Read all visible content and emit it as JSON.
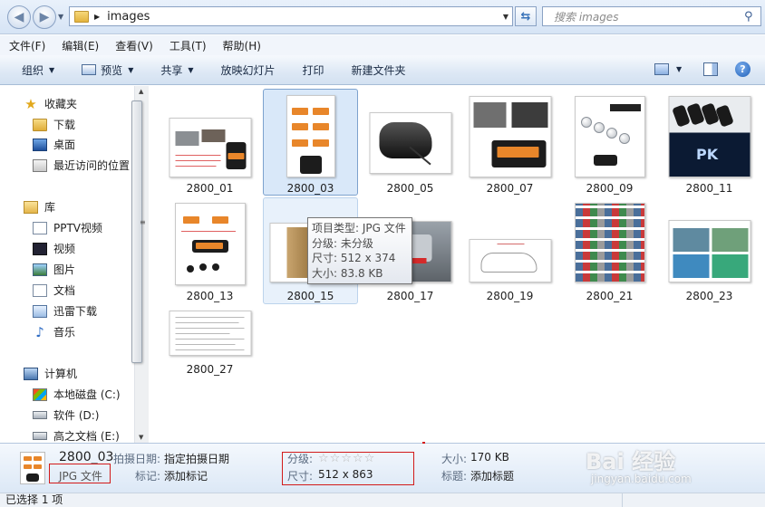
{
  "address": {
    "path_label": "images",
    "search_placeholder": "搜索 images"
  },
  "menu": [
    "文件(F)",
    "编辑(E)",
    "查看(V)",
    "工具(T)",
    "帮助(H)"
  ],
  "toolbar": {
    "organize": "组织",
    "preview": "预览",
    "share": "共享",
    "slideshow": "放映幻灯片",
    "print": "打印",
    "new_folder": "新建文件夹"
  },
  "nav": {
    "favorites": "收藏夹",
    "downloads": "下载",
    "desktop": "桌面",
    "recent": "最近访问的位置",
    "libraries": "库",
    "pptv": "PPTV视频",
    "videos": "视频",
    "pictures": "图片",
    "documents": "文档",
    "thunder": "迅雷下载",
    "music": "音乐",
    "computer": "计算机",
    "drive_c": "本地磁盘 (C:)",
    "drive_d": "软件 (D:)",
    "drive_e": "高之文档 (E:)"
  },
  "files": [
    "2800_01",
    "2800_03",
    "2800_05",
    "2800_07",
    "2800_09",
    "2800_11",
    "2800_13",
    "2800_15",
    "2800_17",
    "2800_19",
    "2800_21",
    "2800_23",
    "2800_27"
  ],
  "tooltip": {
    "type": "项目类型: JPG 文件",
    "rating": "分级: 未分级",
    "dimensions": "尺寸: 512 x 374",
    "size": "大小: 83.8 KB"
  },
  "details": {
    "name": "2800_03",
    "type": "JPG 文件",
    "date_label": "拍摄日期:",
    "date_value": "指定拍摄日期",
    "tags_label": "标记:",
    "tags_value": "添加标记",
    "rating_label": "分级:",
    "dims_label": "尺寸:",
    "dims_value": "512 x 863",
    "size_label": "大小:",
    "size_value": "170 KB",
    "title_label": "标题:",
    "title_value": "添加标题"
  },
  "watermark": {
    "main": "Bai 经验",
    "sub": "jingyan.baidu.com"
  },
  "status": {
    "selected": "已选择 1 项"
  }
}
